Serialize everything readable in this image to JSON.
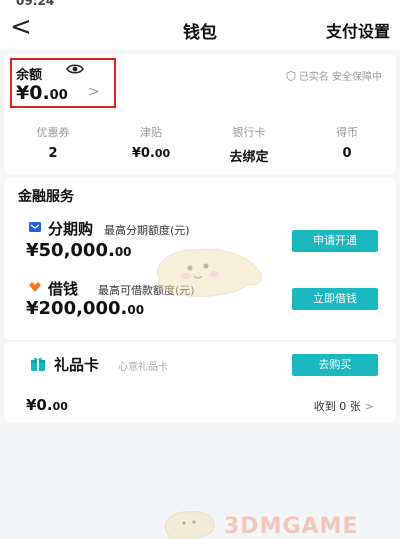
{
  "status_bar": {
    "time": "09:24"
  },
  "nav": {
    "back": "<",
    "title": "钱包",
    "right_link": "支付设置"
  },
  "balance": {
    "label": "余额",
    "value_main": "¥0.",
    "value_decimal": "00",
    "chevron": ">",
    "verified_text": "已实名 安全保障中"
  },
  "stats": [
    {
      "label": "优惠券",
      "value": "2"
    },
    {
      "label": "津贴",
      "value_main": "¥0.",
      "value_decimal": "00"
    },
    {
      "label": "银行卡",
      "value": "去绑定"
    },
    {
      "label": "得币",
      "value": "0"
    }
  ],
  "finance": {
    "title": "金融服务",
    "installment": {
      "title": "分期购",
      "subtitle": "最高分期额度(元)",
      "amount_main": "¥50,000.",
      "amount_decimal": "00",
      "button": "申请开通"
    },
    "loan": {
      "title": "借钱",
      "subtitle": "最高可借款额度(元)",
      "amount_main": "¥200,000.",
      "amount_decimal": "00",
      "button": "立即借钱"
    }
  },
  "gift": {
    "title": "礼品卡",
    "subtitle": "心意礼品卡",
    "button": "去购买",
    "amount_main": "¥0.",
    "amount_decimal": "00",
    "received": "收到 0 张",
    "chevron": ">"
  },
  "watermark": {
    "text": "3DMGAME"
  },
  "colors": {
    "accent": "#1bb7bf",
    "highlight_border": "#e3211e",
    "loan_icon": "#f07b1d",
    "installment_icon": "#1e63d6"
  }
}
